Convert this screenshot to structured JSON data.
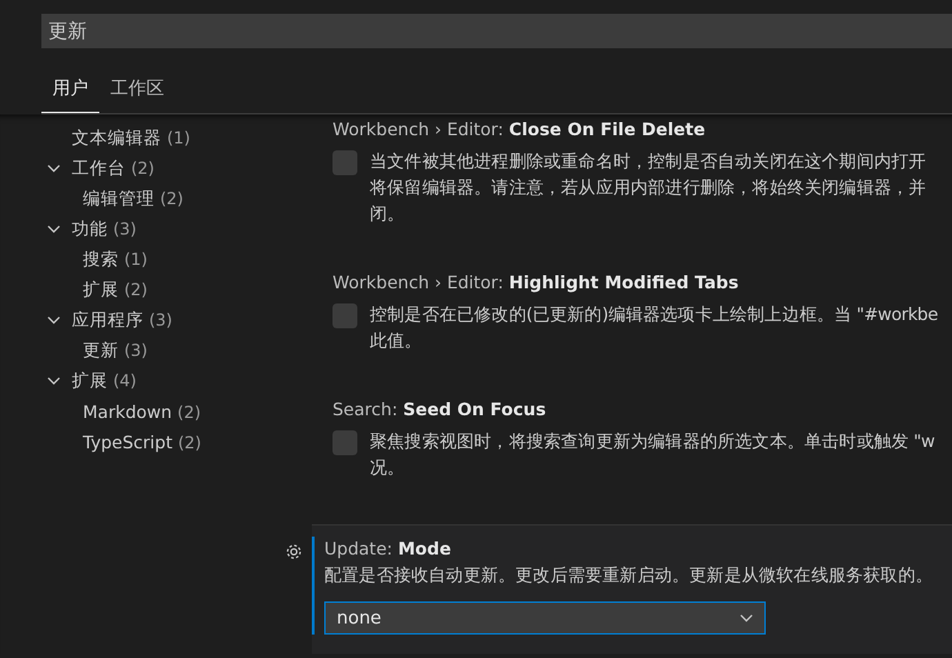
{
  "search": {
    "value": "更新"
  },
  "tabs": [
    {
      "label": "用户",
      "selected": true
    },
    {
      "label": "工作区",
      "selected": false
    }
  ],
  "tree": [
    {
      "label": "文本编辑器",
      "count": "(1)"
    },
    {
      "label": "工作台",
      "count": "(2)",
      "expanded": true,
      "children": [
        {
          "label": "编辑管理",
          "count": "(2)"
        }
      ]
    },
    {
      "label": "功能",
      "count": "(3)",
      "expanded": true,
      "children": [
        {
          "label": "搜索",
          "count": "(1)"
        },
        {
          "label": "扩展",
          "count": "(2)"
        }
      ]
    },
    {
      "label": "应用程序",
      "count": "(3)",
      "expanded": true,
      "children": [
        {
          "label": "更新",
          "count": "(3)"
        }
      ]
    },
    {
      "label": "扩展",
      "count": "(4)",
      "expanded": true,
      "children": [
        {
          "label": "Markdown",
          "count": "(2)"
        },
        {
          "label": "TypeScript",
          "count": "(2)"
        }
      ]
    }
  ],
  "settings": [
    {
      "kind": "checkbox",
      "category": "Workbench › Editor: ",
      "name": "Close On File Delete",
      "checked": false,
      "focused": false,
      "description": [
        "当文件被其他进程删除或重命名时，控制是否自动关闭在这个期间内打开",
        "将保留编辑器。请注意，若从应用内部进行删除，将始终关闭编辑器，并",
        "闭。"
      ]
    },
    {
      "kind": "checkbox",
      "category": "Workbench › Editor: ",
      "name": "Highlight Modified Tabs",
      "checked": false,
      "focused": false,
      "description": [
        "控制是否在已修改的(已更新的)编辑器选项卡上绘制上边框。当 \"#workbe",
        "此值。"
      ]
    },
    {
      "kind": "checkbox",
      "category": "Search: ",
      "name": "Seed On Focus",
      "checked": false,
      "focused": false,
      "description": [
        "聚焦搜索视图时，将搜索查询更新为编辑器的所选文本。单击时或触发 \"w",
        "况。"
      ]
    },
    {
      "kind": "dropdown",
      "category": "Update: ",
      "name": "Mode",
      "focused": true,
      "description": [
        "配置是否接收自动更新。更改后需要重新启动。更新是从微软在线服务获取的。"
      ],
      "value": "none"
    }
  ]
}
